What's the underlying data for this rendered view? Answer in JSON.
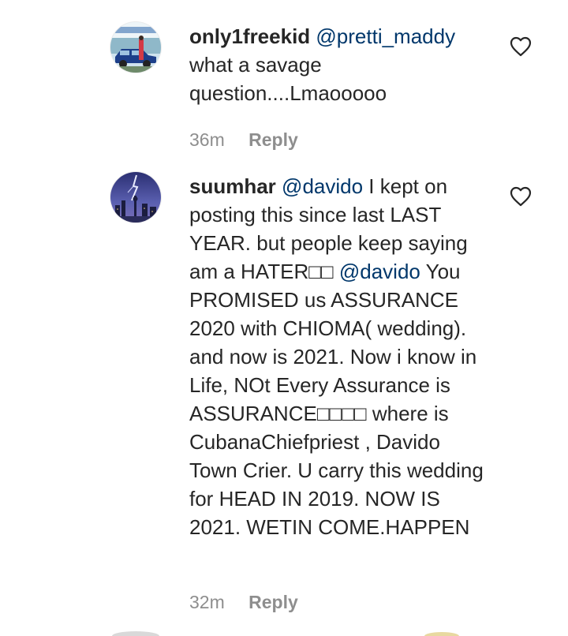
{
  "comments": [
    {
      "username": "only1freekid",
      "mention": "@pretti_maddy",
      "text": "what a savage question....Lmaooooo",
      "time": "36m",
      "reply_label": "Reply",
      "avatar_icon": "car-photo-avatar"
    },
    {
      "username": "suumhar",
      "mention1": "@davido",
      "text1": "I kept on posting this since last LAST YEAR. but people keep saying am a HATER□□",
      "mention2": "@davido",
      "text2": "You PROMISED us ASSURANCE 2020 with CHIOMA( wedding). and now is 2021. Now i know in Life, NOt Every Assurance is ASSURANCE□□□□ where is CubanaChiefpriest , Davido Town Crier. U carry this wedding for HEAD IN 2019. NOW IS 2021. WETIN COME.HAPPEN",
      "time": "32m",
      "reply_label": "Reply",
      "avatar_icon": "city-lightning-avatar"
    }
  ],
  "colors": {
    "text": "#262626",
    "mention": "#00376b",
    "meta": "#8e8e8e"
  }
}
